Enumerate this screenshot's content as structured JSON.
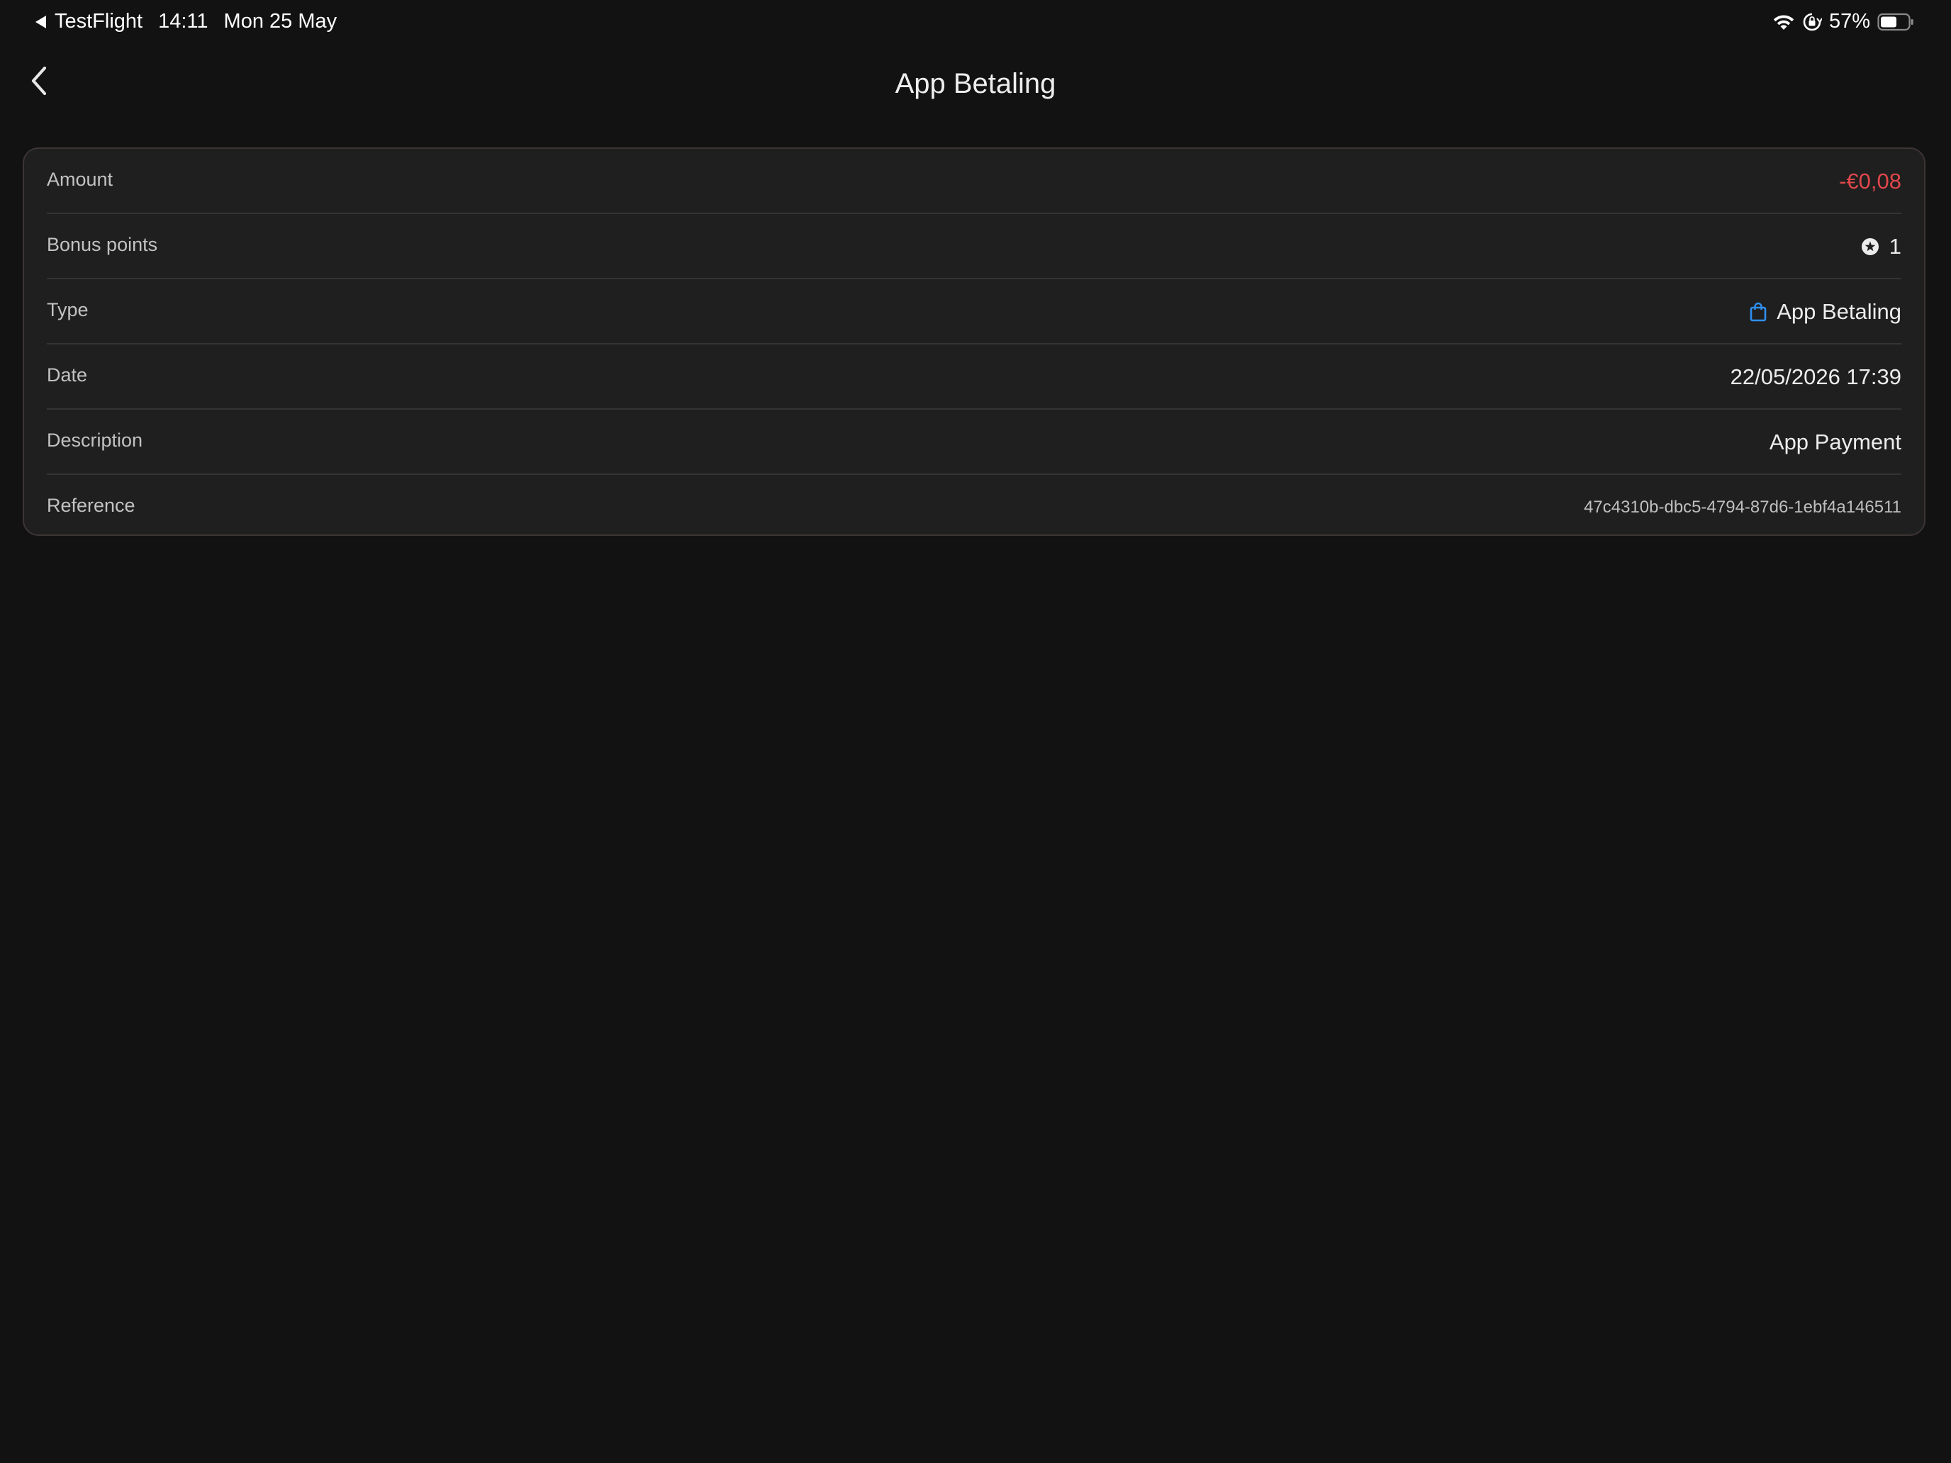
{
  "statusbar": {
    "back_app": "TestFlight",
    "time": "14:11",
    "date": "Mon 25 May",
    "battery": "57%"
  },
  "navbar": {
    "title": "App Betaling"
  },
  "details": {
    "amount_label": "Amount",
    "amount_value": "-€0,08",
    "bonus_label": "Bonus points",
    "bonus_value": "1",
    "type_label": "Type",
    "type_value": "App Betaling",
    "date_label": "Date",
    "date_value": "22/05/2026 17:39",
    "description_label": "Description",
    "description_value": "App Payment",
    "reference_label": "Reference",
    "reference_value": "47c4310b-dbc5-4794-87d6-1ebf4a146511"
  },
  "icons": {
    "back": "chevron-left-icon",
    "bonus": "star-circle-icon",
    "type": "shopping-bag-icon",
    "wifi": "wifi-icon",
    "orientation_lock": "orientation-lock-icon",
    "battery": "battery-icon"
  },
  "colors": {
    "background": "#121212",
    "card": "#1f1f1f",
    "negative_amount": "#e0474b",
    "accent_blue": "#2f8ff0"
  }
}
